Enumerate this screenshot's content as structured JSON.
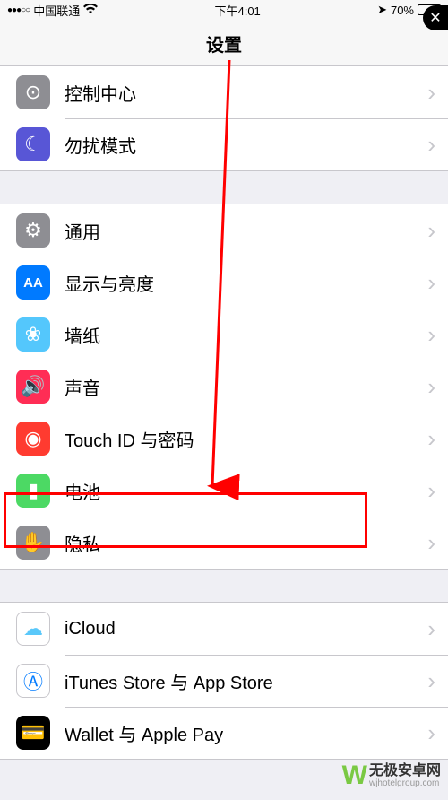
{
  "status": {
    "carrier": "中国联通",
    "time": "下午4:01",
    "battery_pct": "70%"
  },
  "title": "设置",
  "groups": [
    {
      "items": [
        {
          "id": "control-center",
          "label": "控制中心",
          "icon_bg": "#8e8e93",
          "icon_glyph": "⊙"
        },
        {
          "id": "dnd",
          "label": "勿扰模式",
          "icon_bg": "#5856d6",
          "icon_glyph": "☾"
        }
      ]
    },
    {
      "items": [
        {
          "id": "general",
          "label": "通用",
          "icon_bg": "#8e8e93",
          "icon_glyph": "⚙"
        },
        {
          "id": "display",
          "label": "显示与亮度",
          "icon_bg": "#007aff",
          "icon_text": "AA"
        },
        {
          "id": "wallpaper",
          "label": "墙纸",
          "icon_bg": "#54c7fc",
          "icon_glyph": "❀"
        },
        {
          "id": "sound",
          "label": "声音",
          "icon_bg": "#ff2d55",
          "icon_glyph": "🔊"
        },
        {
          "id": "touchid",
          "label": "Touch ID 与密码",
          "icon_bg": "#ff3b30",
          "icon_glyph": "◉"
        },
        {
          "id": "battery",
          "label": "电池",
          "icon_bg": "#4cd964",
          "icon_glyph": "▮"
        },
        {
          "id": "privacy",
          "label": "隐私",
          "icon_bg": "#8e8e93",
          "icon_glyph": "✋",
          "highlight": true
        }
      ]
    },
    {
      "items": [
        {
          "id": "icloud",
          "label": "iCloud",
          "sub": " ",
          "icon_bg": "#ffffff",
          "icon_glyph": "☁",
          "icon_fg": "#5ac8fa",
          "icon_border": true
        },
        {
          "id": "itunes",
          "label": "iTunes Store 与 App Store",
          "icon_bg": "#ffffff",
          "icon_glyph": "Ⓐ",
          "icon_fg": "#007aff",
          "icon_border": true
        },
        {
          "id": "wallet",
          "label": "Wallet 与 Apple Pay",
          "icon_bg": "#000000",
          "icon_glyph": "💳"
        }
      ]
    }
  ],
  "watermark": {
    "name": "无极安卓网",
    "url": "wjhotelgroup.com"
  }
}
